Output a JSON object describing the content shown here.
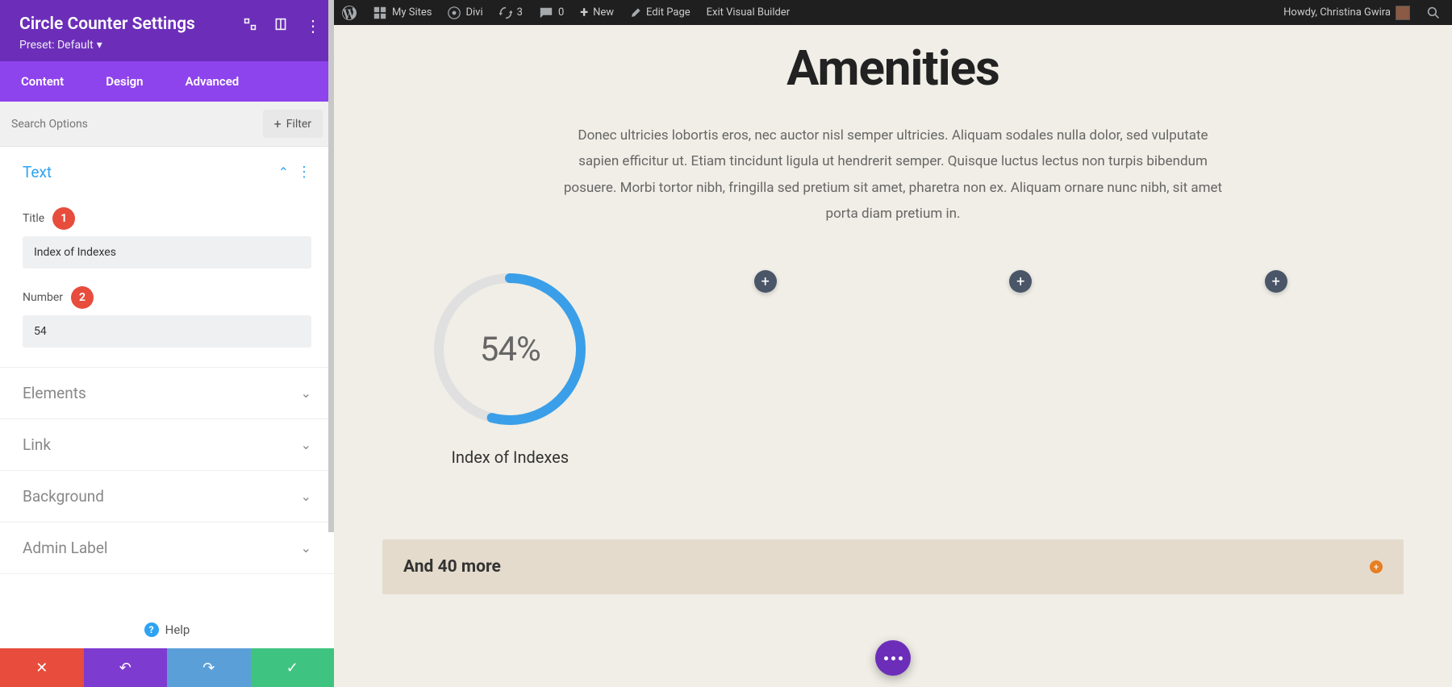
{
  "adminbar": {
    "my_sites": "My Sites",
    "divi": "Divi",
    "updates": "3",
    "comments": "0",
    "new": "New",
    "edit_page": "Edit Page",
    "exit_vb": "Exit Visual Builder",
    "howdy": "Howdy, Christina Gwira"
  },
  "sidebar": {
    "title": "Circle Counter Settings",
    "preset": "Preset: Default",
    "tabs": {
      "content": "Content",
      "design": "Design",
      "advanced": "Advanced"
    },
    "search_placeholder": "Search Options",
    "filter": "Filter",
    "sections": {
      "text": "Text",
      "elements": "Elements",
      "link": "Link",
      "background": "Background",
      "admin_label": "Admin Label"
    },
    "fields": {
      "title_label": "Title",
      "title_badge": "1",
      "title_value": "Index of Indexes",
      "number_label": "Number",
      "number_badge": "2",
      "number_value": "54"
    },
    "help": "Help"
  },
  "preview": {
    "heading": "Amenities",
    "paragraph": "Donec ultricies lobortis eros, nec auctor nisl semper ultricies. Aliquam sodales nulla dolor, sed vulputate sapien efficitur ut. Etiam tincidunt ligula ut hendrerit semper. Quisque luctus lectus non turpis bibendum posuere. Morbi tortor nibh, fringilla sed pretium sit amet, pharetra non ex. Aliquam ornare nunc nibh, sit amet porta diam pretium in.",
    "circle": {
      "percent_text": "54%",
      "title": "Index of Indexes",
      "percent_value": 54
    },
    "more": "And 40 more"
  }
}
